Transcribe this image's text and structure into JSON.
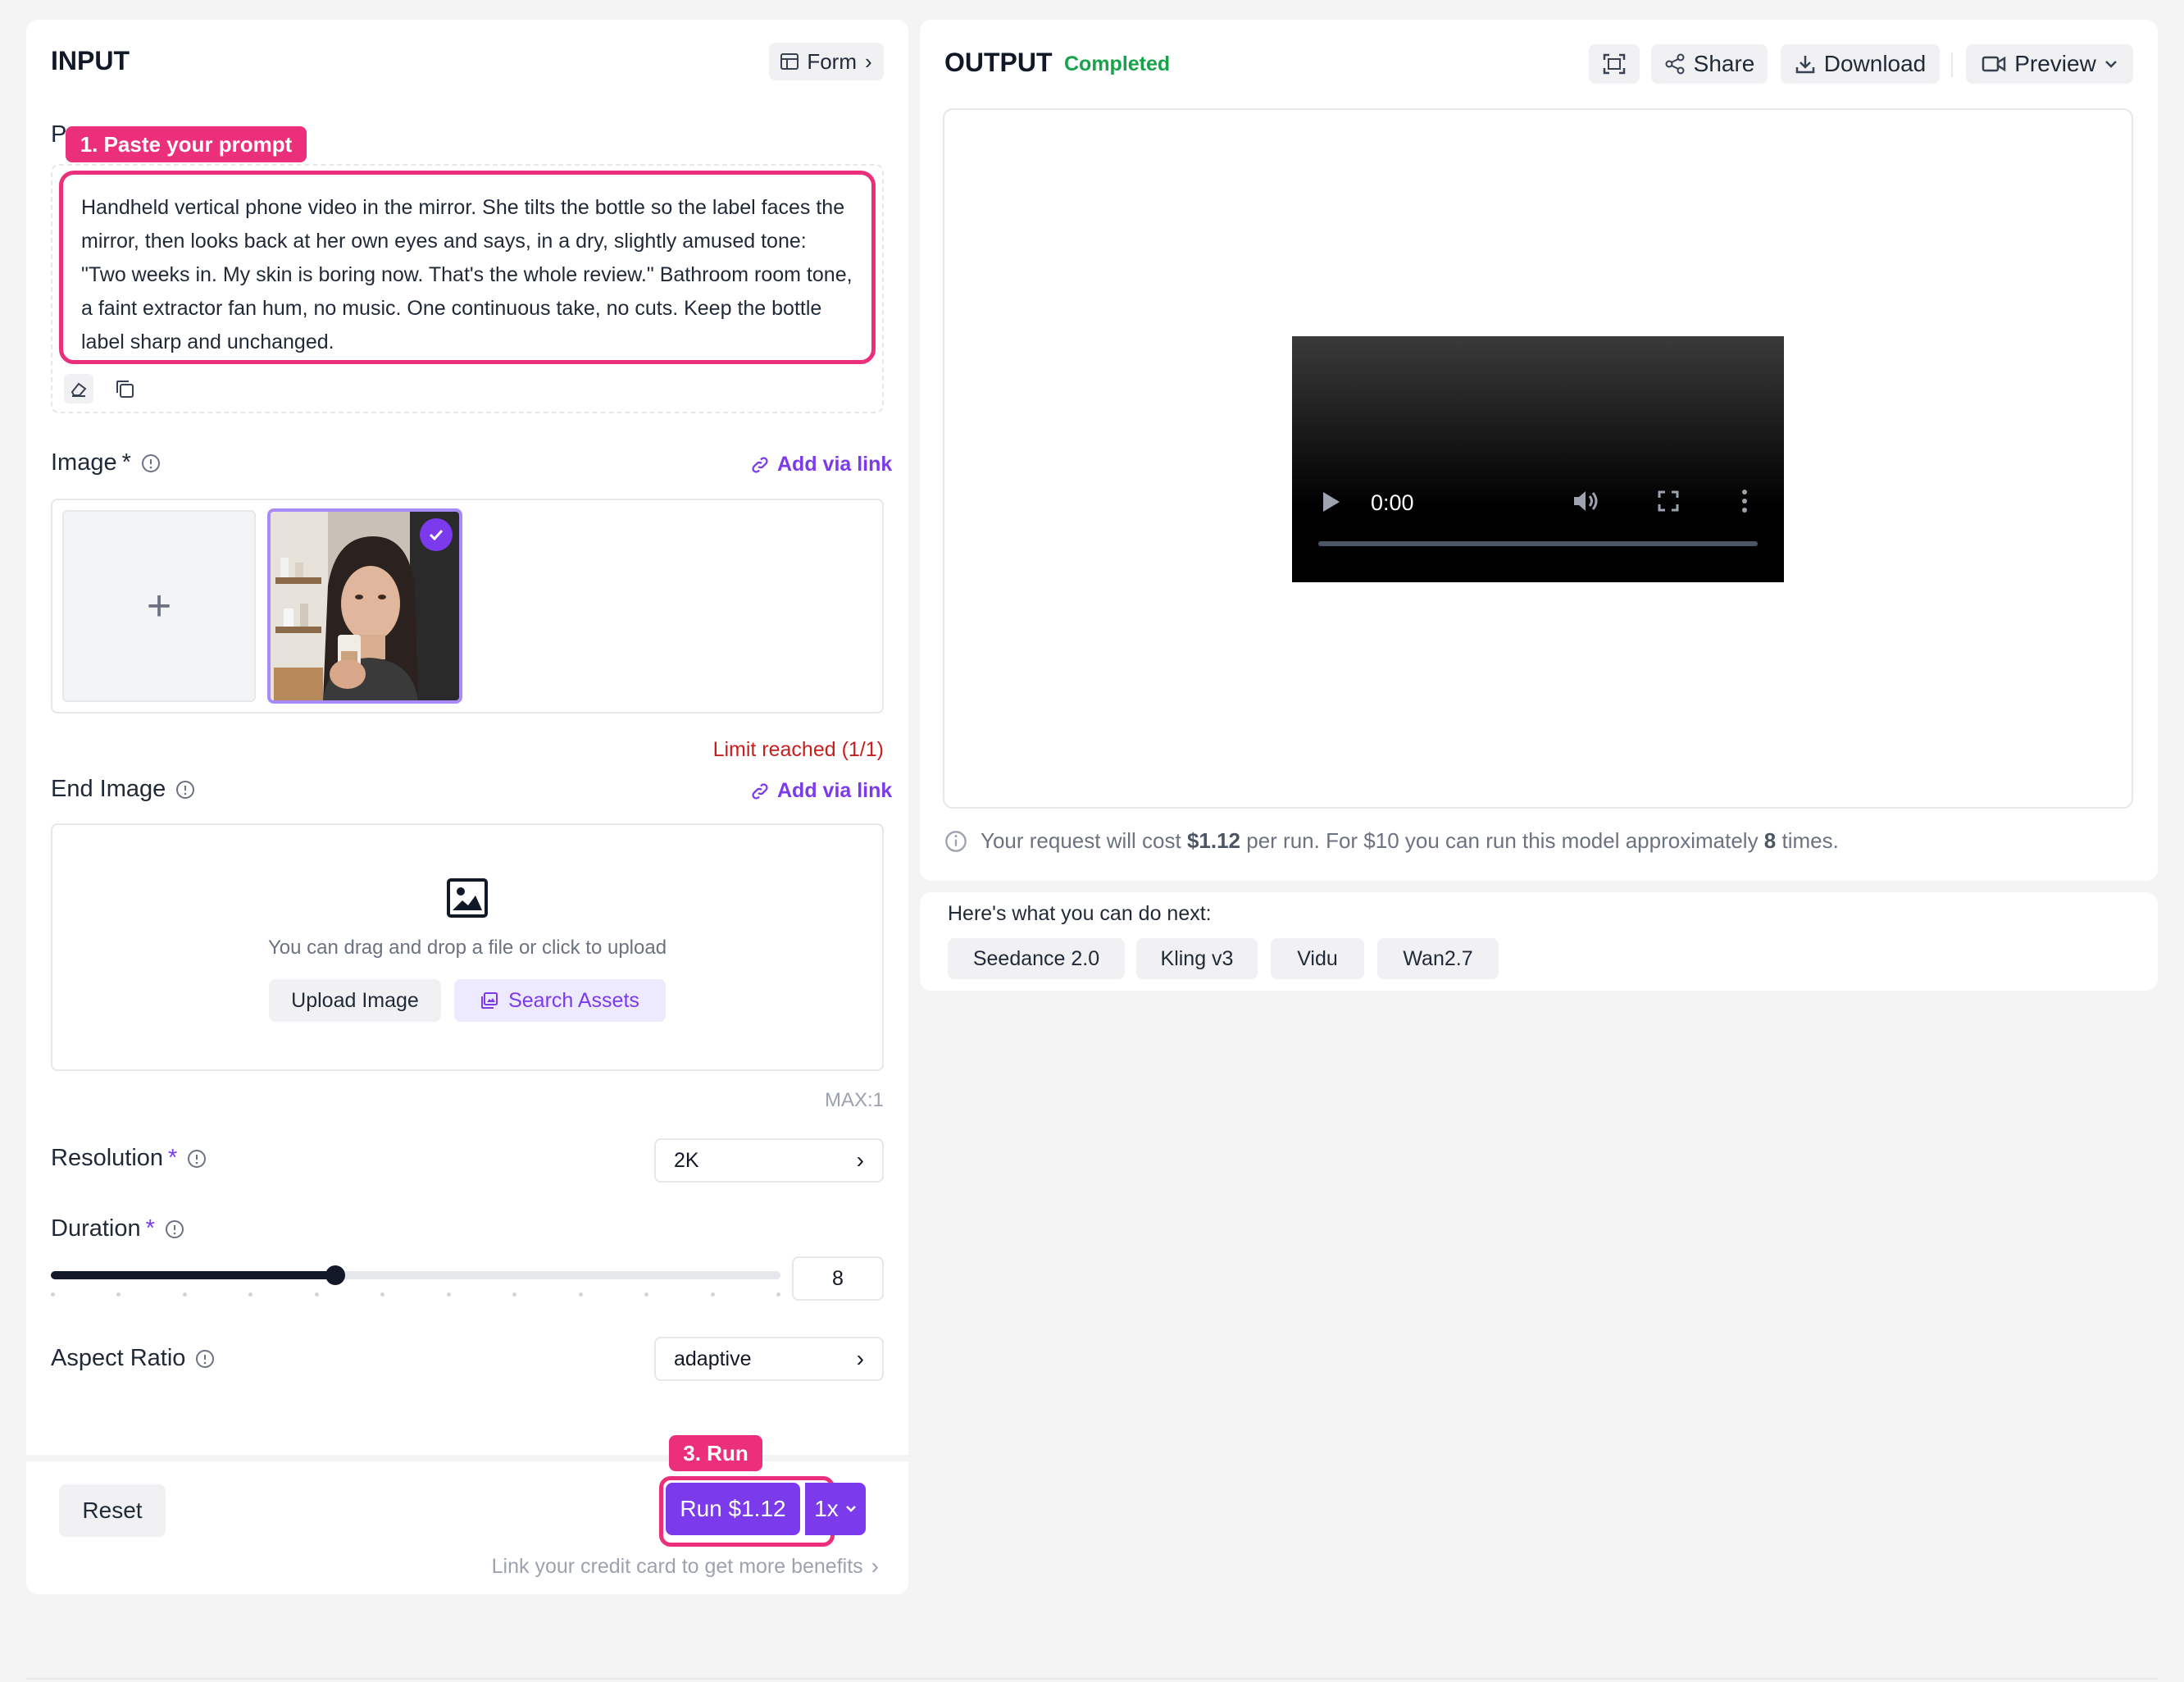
{
  "input": {
    "title": "INPUT",
    "form_label": "Form",
    "prompt": {
      "label_fragment": "P",
      "annotation": "1. Paste your prompt",
      "value": "Handheld vertical phone video in the mirror. She tilts the bottle so the label faces the mirror, then looks back at her own eyes and says, in a dry, slightly amused tone: \"Two weeks in. My skin is boring now. That's the whole review.\" Bathroom room tone, a faint extractor fan hum, no music. One continuous take, no cuts. Keep the bottle label sharp and unchanged."
    },
    "image": {
      "label": "Image",
      "required_mark": "*",
      "add_via_link": "Add via link",
      "limit_text": "Limit reached (1/1)"
    },
    "end_image": {
      "label": "End Image",
      "add_via_link": "Add via link",
      "drop_text": "You can drag and drop a file or click to upload",
      "upload_button": "Upload Image",
      "search_button": "Search Assets",
      "max_text": "MAX:1"
    },
    "resolution": {
      "label": "Resolution",
      "required_mark": "*",
      "value": "2K"
    },
    "duration": {
      "label": "Duration",
      "required_mark": "*",
      "value": "8",
      "fraction": 0.39
    },
    "aspect_ratio": {
      "label": "Aspect Ratio",
      "value": "adaptive"
    },
    "footer": {
      "reset": "Reset",
      "run_annotation": "3. Run",
      "run_label": "Run $1.12",
      "multiplier": "1x",
      "credit_text": "Link your credit card to get more benefits"
    }
  },
  "output": {
    "title": "OUTPUT",
    "status": "Completed",
    "share": "Share",
    "download": "Download",
    "preview": "Preview",
    "video_time": "0:00",
    "cost_text_prefix": "Your request will cost ",
    "cost_value": "$1.12",
    "cost_text_mid": " per run. For $10 you can run this model approximately ",
    "cost_times": "8",
    "cost_text_suffix": " times."
  },
  "next": {
    "heading": "Here's what you can do next:",
    "items": [
      "Seedance 2.0",
      "Kling v3",
      "Vidu",
      "Wan2.7"
    ]
  },
  "colors": {
    "accent": "#7c3aed",
    "annotation": "#ec2f7b",
    "status_green": "#16a34a",
    "limit_red": "#dc2626"
  }
}
